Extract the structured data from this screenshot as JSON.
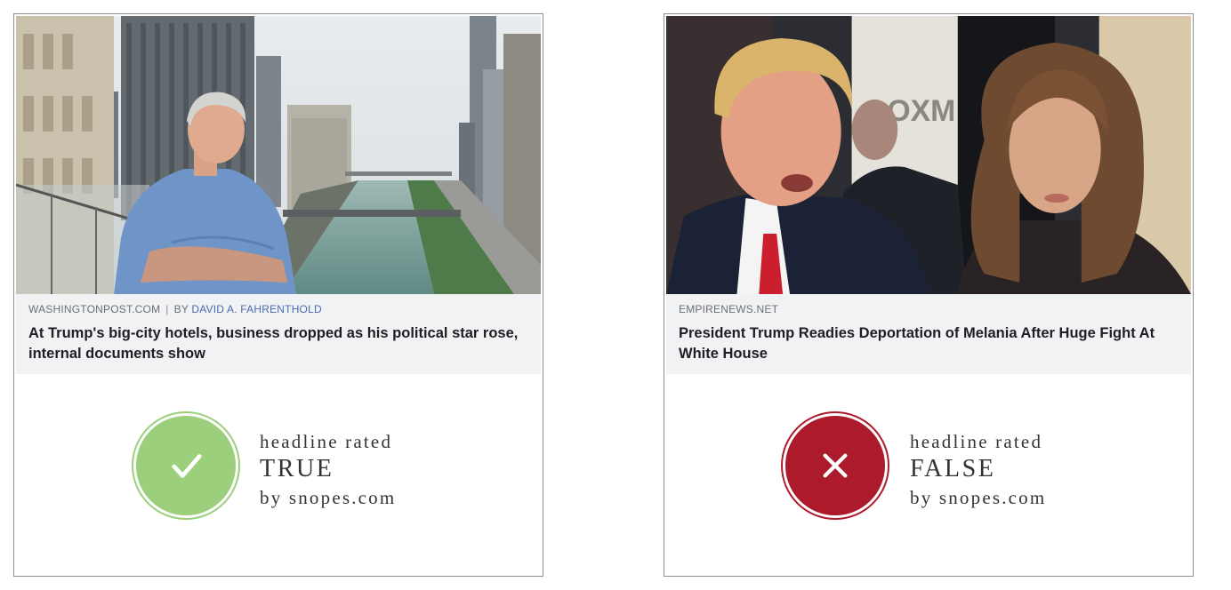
{
  "cards": [
    {
      "source": "WASHINGTONPOST.COM",
      "separator": "|",
      "by": "BY",
      "author": "DAVID A. FAHRENTHOLD",
      "headline": "At Trump's big-city hotels, business dropped as his political star rose, internal documents show",
      "rating": {
        "line1": "headline rated",
        "verdict": "TRUE",
        "line3": "by snopes.com",
        "icon": "checkmark-icon",
        "color": "#9bcf7b"
      }
    },
    {
      "source": "EMPIRENEWS.NET",
      "headline": "President Trump Readies Deportation of Melania After Huge Fight At White House",
      "rating": {
        "line1": "headline rated",
        "verdict": "FALSE",
        "line3": "by snopes.com",
        "icon": "cross-icon",
        "color": "#ad1a2b"
      }
    }
  ]
}
